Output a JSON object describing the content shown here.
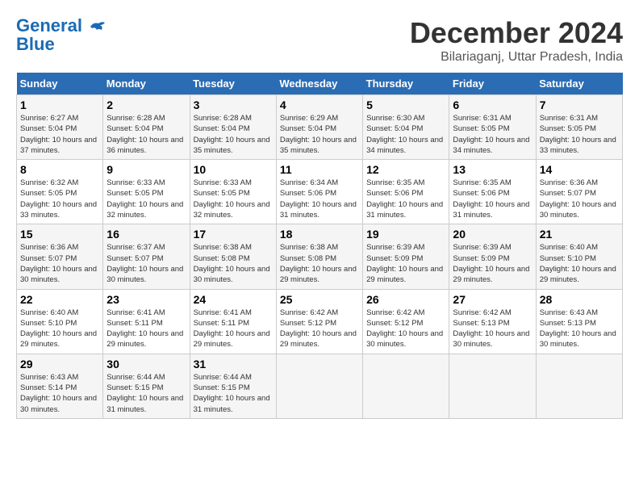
{
  "header": {
    "logo_line1": "General",
    "logo_line2": "Blue",
    "title": "December 2024",
    "subtitle": "Bilariaganj, Uttar Pradesh, India"
  },
  "calendar": {
    "days_of_week": [
      "Sunday",
      "Monday",
      "Tuesday",
      "Wednesday",
      "Thursday",
      "Friday",
      "Saturday"
    ],
    "weeks": [
      [
        null,
        {
          "day": "2",
          "sunrise": "6:28 AM",
          "sunset": "5:04 PM",
          "daylight": "10 hours and 36 minutes."
        },
        {
          "day": "3",
          "sunrise": "6:28 AM",
          "sunset": "5:04 PM",
          "daylight": "10 hours and 35 minutes."
        },
        {
          "day": "4",
          "sunrise": "6:29 AM",
          "sunset": "5:04 PM",
          "daylight": "10 hours and 35 minutes."
        },
        {
          "day": "5",
          "sunrise": "6:30 AM",
          "sunset": "5:04 PM",
          "daylight": "10 hours and 34 minutes."
        },
        {
          "day": "6",
          "sunrise": "6:31 AM",
          "sunset": "5:05 PM",
          "daylight": "10 hours and 34 minutes."
        },
        {
          "day": "7",
          "sunrise": "6:31 AM",
          "sunset": "5:05 PM",
          "daylight": "10 hours and 33 minutes."
        }
      ],
      [
        {
          "day": "1",
          "sunrise": "6:27 AM",
          "sunset": "5:04 PM",
          "daylight": "10 hours and 37 minutes."
        },
        null,
        null,
        null,
        null,
        null,
        null
      ],
      [
        {
          "day": "8",
          "sunrise": "6:32 AM",
          "sunset": "5:05 PM",
          "daylight": "10 hours and 33 minutes."
        },
        {
          "day": "9",
          "sunrise": "6:33 AM",
          "sunset": "5:05 PM",
          "daylight": "10 hours and 32 minutes."
        },
        {
          "day": "10",
          "sunrise": "6:33 AM",
          "sunset": "5:05 PM",
          "daylight": "10 hours and 32 minutes."
        },
        {
          "day": "11",
          "sunrise": "6:34 AM",
          "sunset": "5:06 PM",
          "daylight": "10 hours and 31 minutes."
        },
        {
          "day": "12",
          "sunrise": "6:35 AM",
          "sunset": "5:06 PM",
          "daylight": "10 hours and 31 minutes."
        },
        {
          "day": "13",
          "sunrise": "6:35 AM",
          "sunset": "5:06 PM",
          "daylight": "10 hours and 31 minutes."
        },
        {
          "day": "14",
          "sunrise": "6:36 AM",
          "sunset": "5:07 PM",
          "daylight": "10 hours and 30 minutes."
        }
      ],
      [
        {
          "day": "15",
          "sunrise": "6:36 AM",
          "sunset": "5:07 PM",
          "daylight": "10 hours and 30 minutes."
        },
        {
          "day": "16",
          "sunrise": "6:37 AM",
          "sunset": "5:07 PM",
          "daylight": "10 hours and 30 minutes."
        },
        {
          "day": "17",
          "sunrise": "6:38 AM",
          "sunset": "5:08 PM",
          "daylight": "10 hours and 30 minutes."
        },
        {
          "day": "18",
          "sunrise": "6:38 AM",
          "sunset": "5:08 PM",
          "daylight": "10 hours and 29 minutes."
        },
        {
          "day": "19",
          "sunrise": "6:39 AM",
          "sunset": "5:09 PM",
          "daylight": "10 hours and 29 minutes."
        },
        {
          "day": "20",
          "sunrise": "6:39 AM",
          "sunset": "5:09 PM",
          "daylight": "10 hours and 29 minutes."
        },
        {
          "day": "21",
          "sunrise": "6:40 AM",
          "sunset": "5:10 PM",
          "daylight": "10 hours and 29 minutes."
        }
      ],
      [
        {
          "day": "22",
          "sunrise": "6:40 AM",
          "sunset": "5:10 PM",
          "daylight": "10 hours and 29 minutes."
        },
        {
          "day": "23",
          "sunrise": "6:41 AM",
          "sunset": "5:11 PM",
          "daylight": "10 hours and 29 minutes."
        },
        {
          "day": "24",
          "sunrise": "6:41 AM",
          "sunset": "5:11 PM",
          "daylight": "10 hours and 29 minutes."
        },
        {
          "day": "25",
          "sunrise": "6:42 AM",
          "sunset": "5:12 PM",
          "daylight": "10 hours and 29 minutes."
        },
        {
          "day": "26",
          "sunrise": "6:42 AM",
          "sunset": "5:12 PM",
          "daylight": "10 hours and 30 minutes."
        },
        {
          "day": "27",
          "sunrise": "6:42 AM",
          "sunset": "5:13 PM",
          "daylight": "10 hours and 30 minutes."
        },
        {
          "day": "28",
          "sunrise": "6:43 AM",
          "sunset": "5:13 PM",
          "daylight": "10 hours and 30 minutes."
        }
      ],
      [
        {
          "day": "29",
          "sunrise": "6:43 AM",
          "sunset": "5:14 PM",
          "daylight": "10 hours and 30 minutes."
        },
        {
          "day": "30",
          "sunrise": "6:44 AM",
          "sunset": "5:15 PM",
          "daylight": "10 hours and 31 minutes."
        },
        {
          "day": "31",
          "sunrise": "6:44 AM",
          "sunset": "5:15 PM",
          "daylight": "10 hours and 31 minutes."
        },
        null,
        null,
        null,
        null
      ]
    ]
  }
}
